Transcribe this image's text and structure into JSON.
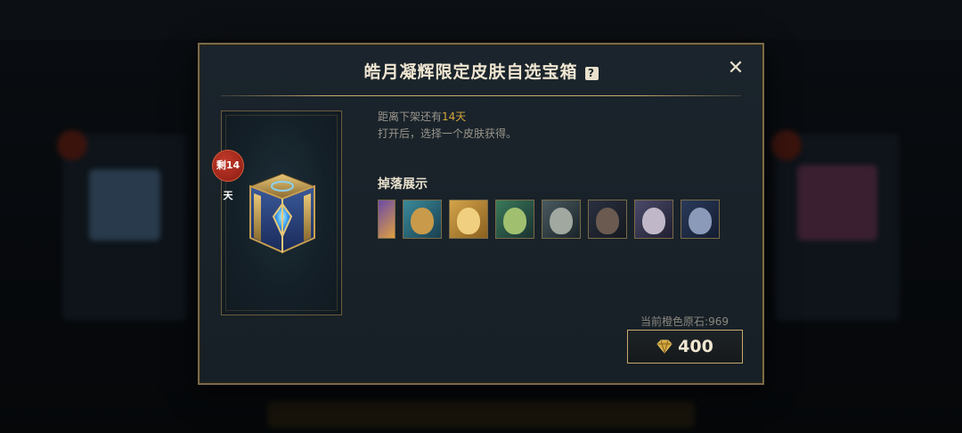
{
  "modal": {
    "title": "皓月凝辉限定皮肤自选宝箱",
    "help_icon": "question-icon",
    "close_icon": "close-icon",
    "badge": "剩14天",
    "time_prefix": "距离下架还有",
    "time_value": "14天",
    "description": "打开后，选择一个皮肤获得。",
    "drops_title": "掉落展示",
    "drops": [
      {
        "icon": "skin-portrait-icon",
        "colors": [
          "#6a4aa8",
          "#e0a040"
        ]
      },
      {
        "icon": "skin-portrait-icon",
        "colors": [
          "#3a8a9a",
          "#c89a4a"
        ]
      },
      {
        "icon": "skin-portrait-icon",
        "colors": [
          "#d4a44a",
          "#f0d080"
        ]
      },
      {
        "icon": "skin-portrait-icon",
        "colors": [
          "#3a7a5a",
          "#a0c070"
        ]
      },
      {
        "icon": "skin-portrait-icon",
        "colors": [
          "#4a5a60",
          "#a0a8a0"
        ]
      },
      {
        "icon": "skin-portrait-icon",
        "colors": [
          "#2a3040",
          "#6a5a50"
        ]
      },
      {
        "icon": "skin-portrait-icon",
        "colors": [
          "#4a4a6a",
          "#c0b8c8"
        ]
      },
      {
        "icon": "skin-portrait-icon",
        "colors": [
          "#2a3a5a",
          "#8a9ab8"
        ]
      }
    ],
    "balance": "当前橙色原石:969",
    "price": "400",
    "accent_color": "#c8aa6e",
    "highlight_color": "#d2a63c"
  }
}
